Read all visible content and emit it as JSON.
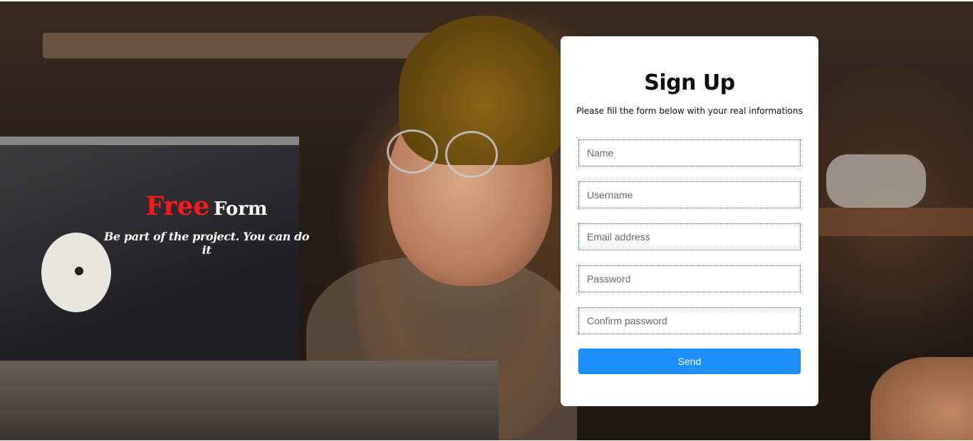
{
  "brand": {
    "word_accent": "Free",
    "word_main": "Form",
    "tagline": "Be part of the project. You can do it"
  },
  "form": {
    "title": "Sign Up",
    "subtitle": "Please fill the form below with your real informations",
    "fields": [
      {
        "placeholder": "Name",
        "value": ""
      },
      {
        "placeholder": "Username",
        "value": ""
      },
      {
        "placeholder": "Email address",
        "value": ""
      },
      {
        "placeholder": "Password",
        "value": ""
      },
      {
        "placeholder": "Confirm password",
        "value": ""
      }
    ],
    "submit_label": "Send"
  },
  "colors": {
    "accent": "#1e8ffe",
    "brand_red": "#ff1a1a",
    "field_border": "#2f6f8f"
  }
}
